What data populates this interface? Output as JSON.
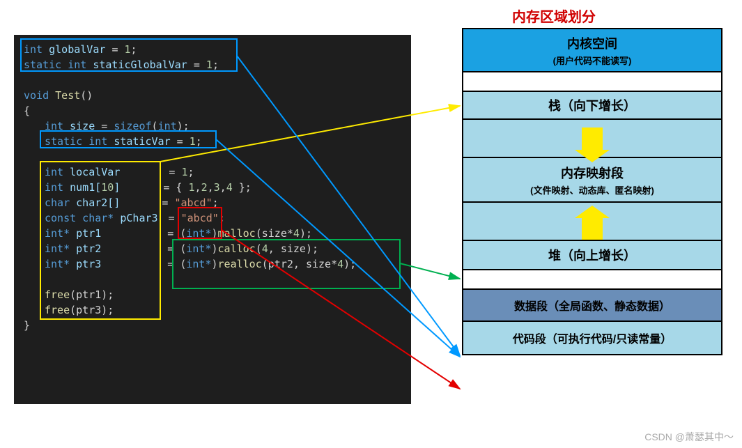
{
  "title": "内存区域划分",
  "code": {
    "l1a": "int",
    "l1b": " globalVar ",
    "l1c": "= ",
    "l1d": "1",
    "l1e": ";",
    "l2a": "static int",
    "l2b": " staticGlobalVar ",
    "l2c": "= ",
    "l2d": "1",
    "l2e": ";",
    "l4a": "void ",
    "l4b": "Test",
    "l4c": "()",
    "l5": "{",
    "l6a": "int",
    "l6b": " size ",
    "l6c": "= ",
    "l6d": "sizeof",
    "l6e": "(",
    "l6f": "int",
    "l6g": ");",
    "l7a": "static int",
    "l7b": " staticVar ",
    "l7c": "= ",
    "l7d": "1",
    "l7e": ";",
    "l9a": "int",
    "l9b": " localVar",
    "l9c": "= ",
    "l9d": "1",
    "l9e": ";",
    "l10a": "int",
    "l10b": " num1[",
    "l10c": "10",
    "l10d": "]",
    "l10e": "= { ",
    "l10f": "1",
    "l10g": ",",
    "l10h": "2",
    "l10i": ",",
    "l10j": "3",
    "l10k": ",",
    "l10l": "4",
    "l10m": " };",
    "l11a": "char",
    "l11b": " char2[]",
    "l11c": "= ",
    "l11d": "\"abcd\"",
    "l11e": ";",
    "l12a": "const char*",
    "l12b": " pChar3",
    "l12c": "= ",
    "l12d": "\"abcd\"",
    "l12e": ";",
    "l13a": "int*",
    "l13b": " ptr1",
    "l13c": "= (",
    "l13d": "int*",
    "l13e": ")",
    "l13f": "malloc",
    "l13g": "(size*",
    "l13h": "4",
    "l13i": ");",
    "l14a": "int*",
    "l14b": " ptr2",
    "l14c": "= (",
    "l14d": "int*",
    "l14e": ")",
    "l14f": "calloc",
    "l14g": "(",
    "l14h": "4",
    "l14i": ", size);",
    "l15a": "int*",
    "l15b": " ptr3",
    "l15c": "= (",
    "l15d": "int*",
    "l15e": ")",
    "l15f": "realloc",
    "l15g": "(ptr2, size*",
    "l15h": "4",
    "l15i": ");",
    "l17a": "free",
    "l17b": "(ptr1);",
    "l18a": "free",
    "l18b": "(ptr3);",
    "l19": "}"
  },
  "mem": {
    "kernel": "内核空间",
    "kernel_sub": "(用户代码不能读写)",
    "stack": "栈（向下增长）",
    "mmap": "内存映射段",
    "mmap_sub": "(文件映射、动态库、匿名映射)",
    "heap": "堆（向上增长）",
    "data": "数据段（全局函数、静态数据）",
    "code": "代码段（可执行代码/只读常量）"
  },
  "watermark": "CSDN @萧瑟其中～"
}
